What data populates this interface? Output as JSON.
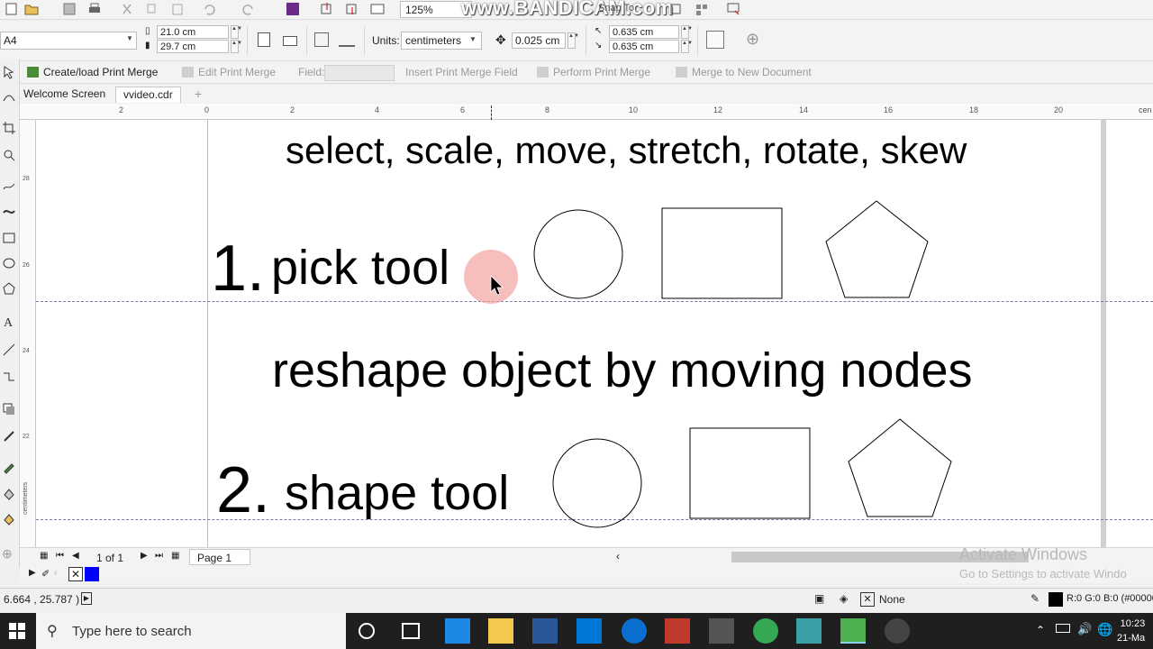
{
  "toolbar": {
    "zoom": "125%",
    "watermark": "www.BANDICAM.com",
    "snap_to": "Snap To"
  },
  "propbar": {
    "page_size": "A4",
    "width": "21.0 cm",
    "height": "29.7 cm",
    "units_label": "Units:",
    "units_value": "centimeters",
    "nudge": "0.025 cm",
    "dup_x": "0.635 cm",
    "dup_y": "0.635 cm"
  },
  "mergebar": {
    "create_load": "Create/load Print Merge",
    "edit": "Edit Print Merge",
    "field_label": "Field:",
    "insert_field": "Insert Print Merge Field",
    "perform": "Perform Print Merge",
    "merge_new": "Merge to New Document"
  },
  "tabs": [
    "Welcome Screen",
    "vvideo.cdr"
  ],
  "ruler": {
    "h_ticks": [
      "2",
      "0",
      "2",
      "4",
      "6",
      "8",
      "10",
      "12",
      "14",
      "16",
      "18",
      "20",
      "cen"
    ],
    "v_ticks": [
      "28",
      "26",
      "24",
      "22"
    ],
    "v_unit": "centimeters"
  },
  "canvas": {
    "line1": "select, scale, move, stretch, rotate, skew",
    "num1": "1.",
    "label1": "pick tool",
    "line2": "reshape object by moving nodes",
    "num2": "2.",
    "label2": "shape tool"
  },
  "navbar": {
    "page_count": "1 of 1",
    "page_tab": "Page 1"
  },
  "activation": {
    "title": "Activate Windows",
    "subtitle": "Go to Settings to activate Windo"
  },
  "statusbar": {
    "coords": "6.664 , 25.787 )",
    "fill": "None",
    "color_readout": "R:0 G:0 B:0 (#00000"
  },
  "taskbar": {
    "search_placeholder": "Type here to search",
    "time": "10:23",
    "date": "21-Ma"
  },
  "colors": {
    "palette_blue": "#0000ff",
    "cursor_highlight": "#f4a3a3"
  }
}
